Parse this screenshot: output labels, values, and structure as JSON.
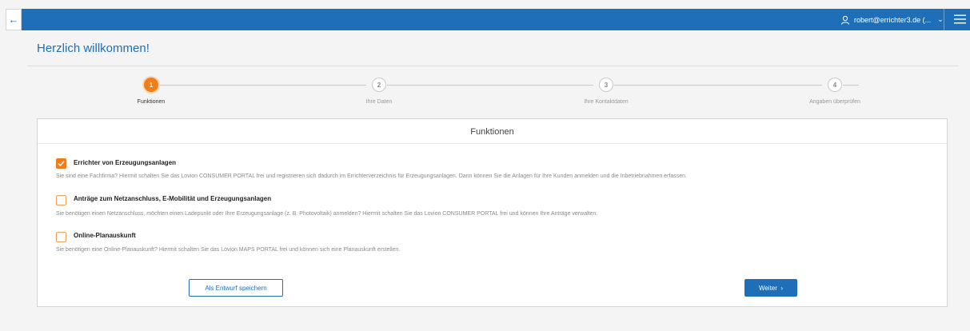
{
  "header": {
    "back_icon": "arrow-left-icon",
    "user_email": "robert@errichter3.de (...",
    "user_icon": "user-icon",
    "dropdown_icon": "chevron-down-icon",
    "menu_icon": "hamburger-menu-icon",
    "brand_color": "#1f6fb8"
  },
  "page": {
    "title": "Herzlich willkommen!"
  },
  "stepper": {
    "steps": [
      {
        "number": "1",
        "label": "Funktionen",
        "active": true
      },
      {
        "number": "2",
        "label": "Ihre Daten",
        "active": false
      },
      {
        "number": "3",
        "label": "Ihre Kontaktdaten",
        "active": false
      },
      {
        "number": "4",
        "label": "Angaben überprüfen",
        "active": false
      }
    ],
    "active_color": "#f07d1a"
  },
  "card": {
    "title": "Funktionen",
    "options": [
      {
        "label": "Errichter von Erzeugungsanlagen",
        "checked": true,
        "description": "Sie sind eine Fachfirma? Hiermit schalten Sie das Lovion CONSUMER PORTAL frei und registrieren sich dadurch im Errichterverzeichnis für Erzeugungsanlagen. Dann können Sie die Anlagen für Ihre Kunden anmelden und die Inbetriebnahmen erfassen."
      },
      {
        "label": "Anträge zum Netzanschluss, E-Mobilität und Erzeugungsanlagen",
        "checked": false,
        "description": "Sie benötigen einen Netzanschluss, möchten einen Ladepunkt oder Ihre Erzeugungsanlage (z. B. Photovoltaik) anmelden? Hiermit schalten Sie das Lovion CONSUMER PORTAL frei und können Ihre Anträge verwalten."
      },
      {
        "label": "Online-Planauskunft",
        "checked": false,
        "description": "Sie benötigen eine Online-Planauskunft? Hiermit schalten Sie das Lovion MAPS PORTAL frei und können sich eine Planauskunft erstellen."
      }
    ],
    "draft_button": "Als Entwurf speichern",
    "next_button": "Weiter",
    "next_icon": "chevron-right-icon"
  }
}
